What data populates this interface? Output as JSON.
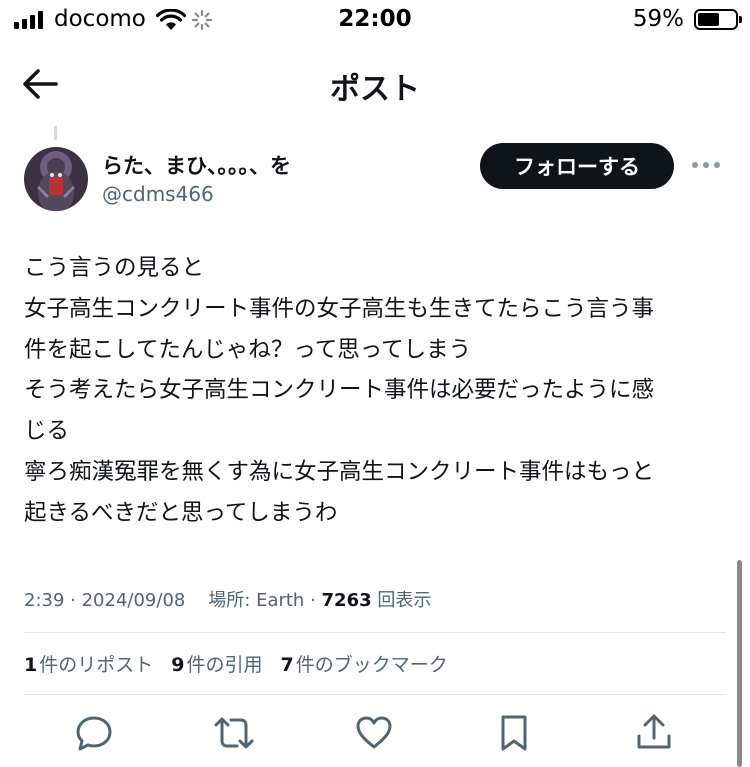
{
  "status_bar": {
    "carrier": "docomo",
    "time": "22:00",
    "battery_percent_text": "59%",
    "battery_level": 0.59
  },
  "nav": {
    "title": "ポスト",
    "back_icon": "arrow-left-icon"
  },
  "author": {
    "display_name": "らた、まひ、。。。、を",
    "handle": "@cdms466",
    "follow_label": "フォローする"
  },
  "tweet": {
    "lines": [
      "こう言うの見ると",
      "女子高生コンクリート事件の女子高生も生きてたらこう言う事",
      "件を起こしてたんじゃね？って思ってしまう",
      "そう考えたら女子高生コンクリート事件は必要だったように感",
      "じる",
      "寧ろ痴漢冤罪を無くす為に女子高生コンクリート事件はもっと",
      "起きるべきだと思ってしまうわ"
    ]
  },
  "meta": {
    "time": "2:39",
    "date": "2024/09/08",
    "location": "場所: Earth",
    "views_count": "7263",
    "views_label": "回表示"
  },
  "stats": {
    "reposts_count": "1",
    "reposts_label": "件のリポスト",
    "quotes_count": "9",
    "quotes_label": "件の引用",
    "bookmarks_count": "7",
    "bookmarks_label": "件のブックマーク"
  },
  "actions": [
    "reply-icon",
    "repost-icon",
    "like-icon",
    "bookmark-icon",
    "share-icon"
  ]
}
